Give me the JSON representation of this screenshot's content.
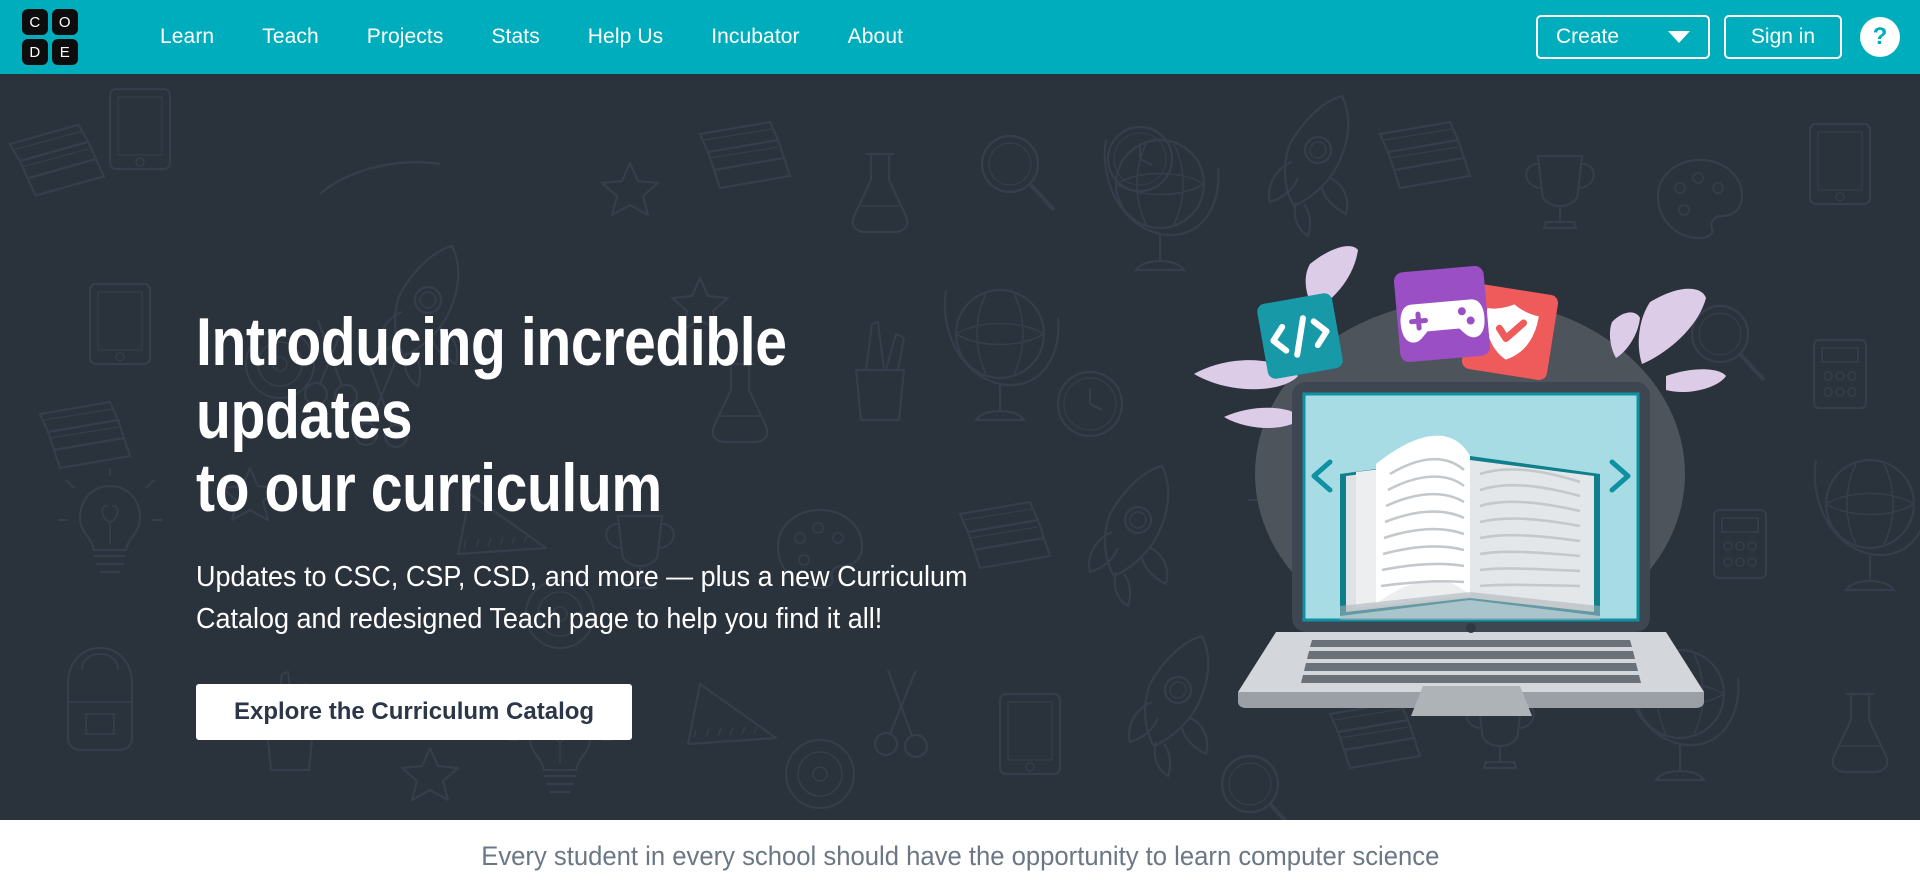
{
  "colors": {
    "teal": "#00adbc",
    "hero_bg": "#2a323c",
    "card_teal": "#1799a8",
    "card_purple": "#9b4fc4",
    "card_red": "#ef5b5b",
    "lavender": "#dccce8",
    "screen_blue": "#a8dce4",
    "laptop_body": "#d3d6da",
    "cta_text": "#2b3648",
    "bottom_text": "#6b7785"
  },
  "header": {
    "logo": {
      "name": "code-org-logo",
      "tiles": [
        "C",
        "O",
        "D",
        "E"
      ]
    },
    "nav": [
      {
        "label": "Learn",
        "name": "nav-item-learn"
      },
      {
        "label": "Teach",
        "name": "nav-item-teach"
      },
      {
        "label": "Projects",
        "name": "nav-item-projects"
      },
      {
        "label": "Stats",
        "name": "nav-item-stats"
      },
      {
        "label": "Help Us",
        "name": "nav-item-help-us"
      },
      {
        "label": "Incubator",
        "name": "nav-item-incubator"
      },
      {
        "label": "About",
        "name": "nav-item-about"
      }
    ],
    "create_label": "Create",
    "create_icon": "caret-down-icon",
    "signin_label": "Sign in",
    "help_label": "?",
    "help_icon": "question-mark-icon"
  },
  "hero": {
    "title": "Introducing incredible updates\nto our curriculum",
    "subtitle": "Updates to CSC, CSP, CSD, and more — plus a new Curriculum\nCatalog and redesigned Teach page to help you find it all!",
    "cta_label": "Explore the Curriculum Catalog",
    "illustration": {
      "name": "laptop-with-open-book-illustration",
      "cards": [
        {
          "name": "code-card-icon",
          "glyph": "</>",
          "color": "#1799a8"
        },
        {
          "name": "gamepad-card-icon",
          "glyph": "gamepad",
          "color": "#9b4fc4"
        },
        {
          "name": "shield-check-card-icon",
          "glyph": "shield-check",
          "color": "#ef5b5b"
        }
      ],
      "screen": {
        "prev_icon": "chevron-left-icon",
        "next_icon": "chevron-right-icon"
      }
    },
    "background_doodles": [
      "rocket-doodle",
      "globe-doodle",
      "books-doodle",
      "star-doodle",
      "lightbulb-doodle",
      "triangle-ruler-doodle",
      "backpack-doodle",
      "scissors-doodle",
      "pencil-cup-doodle",
      "trophy-doodle",
      "magnifier-doodle",
      "calculator-doodle",
      "clock-doodle",
      "paint-palette-doodle",
      "flask-doodle",
      "tablet-doodle"
    ]
  },
  "bottom": {
    "tagline": "Every student in every school should have the opportunity to learn computer science"
  }
}
